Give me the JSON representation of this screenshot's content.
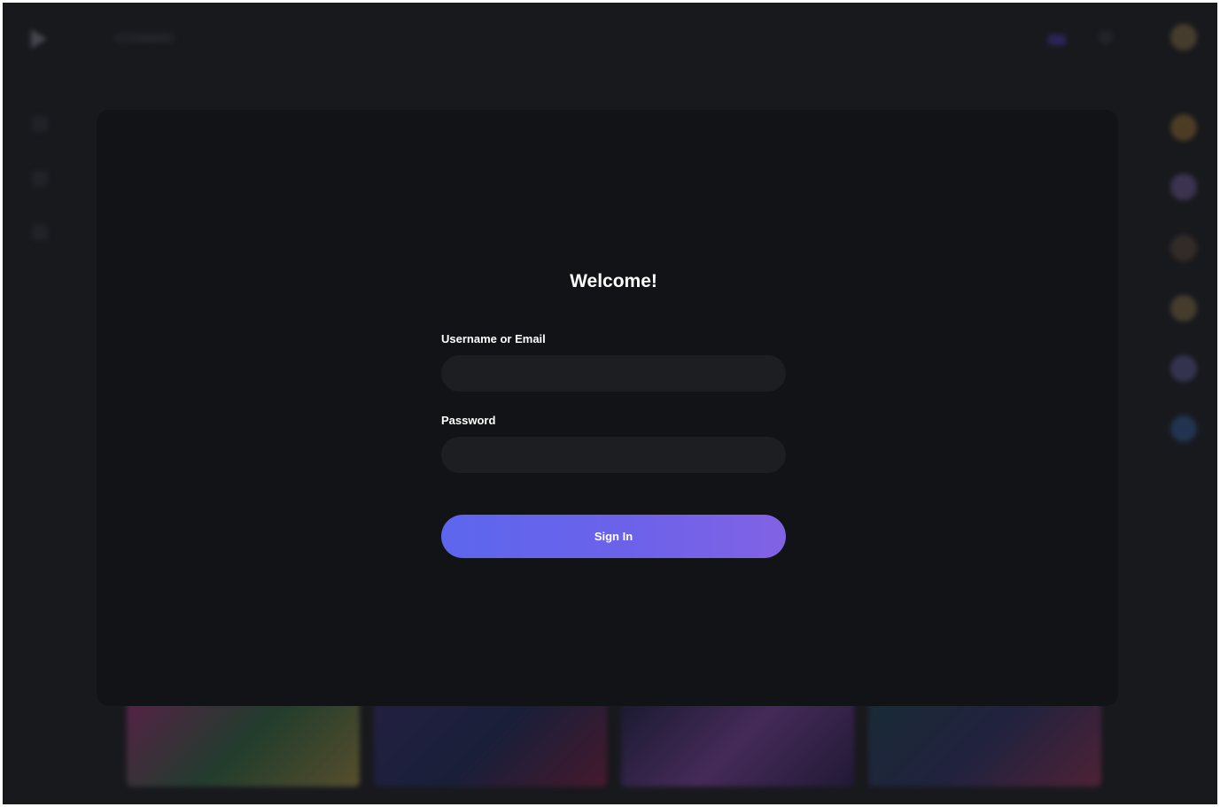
{
  "background_app": {
    "search_placeholder": "Search",
    "thumbnails": [
      "#7a2a5a",
      "#2c2460",
      "#3a2b6a",
      "#2a4356"
    ]
  },
  "login": {
    "title": "Welcome!",
    "username_label": "Username or Email",
    "username_value": "",
    "password_label": "Password",
    "password_value": "",
    "signin_label": "Sign In"
  },
  "colors": {
    "page_bg": "#18191d",
    "modal_bg": "#121316",
    "input_bg": "#1d1e22",
    "accent_start": "#5d66ee",
    "accent_end": "#8262e4"
  }
}
